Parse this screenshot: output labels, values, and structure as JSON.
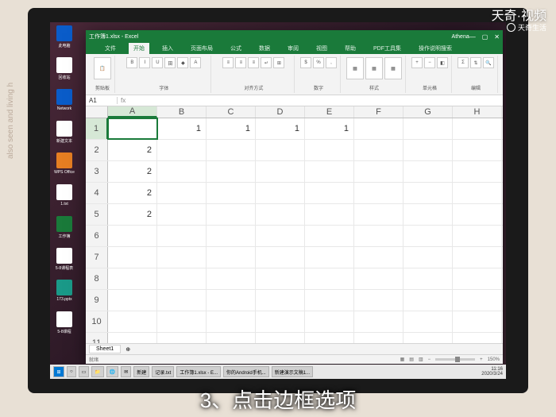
{
  "watermark": {
    "brand": "天奇·视频",
    "sub": "天奇生活"
  },
  "caption": "3、点击边框选项",
  "side_text": "also seen and living h",
  "excel": {
    "title": "工作簿1.xlsx - Excel",
    "account": "Athena",
    "tabs": [
      "文件",
      "开始",
      "插入",
      "页面布局",
      "公式",
      "数据",
      "审阅",
      "视图",
      "帮助",
      "PDF工具集",
      "操作说明搜索"
    ],
    "active_tab": "开始",
    "name_box": "A1",
    "fx": "fx",
    "ribbon_groups": [
      "剪贴板",
      "字体",
      "对齐方式",
      "数字",
      "样式",
      "单元格",
      "编辑"
    ],
    "columns": [
      "A",
      "B",
      "C",
      "D",
      "E",
      "F",
      "G",
      "H"
    ],
    "rows": [
      "1",
      "2",
      "3",
      "4",
      "5",
      "6",
      "7",
      "8",
      "9",
      "10",
      "11"
    ],
    "cells": {
      "B1": "1",
      "C1": "1",
      "D1": "1",
      "E1": "1",
      "A2": "2",
      "A3": "2",
      "A4": "2",
      "A5": "2"
    },
    "selected_cell": "A1",
    "sheet": "Sheet1",
    "status_ready": "就绪",
    "zoom": "150%"
  },
  "taskbar": {
    "items": [
      "⊞",
      "○",
      "▭",
      "📁",
      "🌐",
      "✉",
      "新建",
      "记录.txt",
      "工作簿1.xlsx - E...",
      "你的Android手机...",
      "新建演示文稿1..."
    ],
    "time": "11:16",
    "date": "2020/3/24"
  },
  "desktop": {
    "icons": [
      "此电脑",
      "回收站",
      "Network",
      "新建文本",
      "WPS Office",
      "1.txt",
      "工作簿",
      "5-8课程表",
      "173.pptx",
      "5-8课程"
    ]
  }
}
